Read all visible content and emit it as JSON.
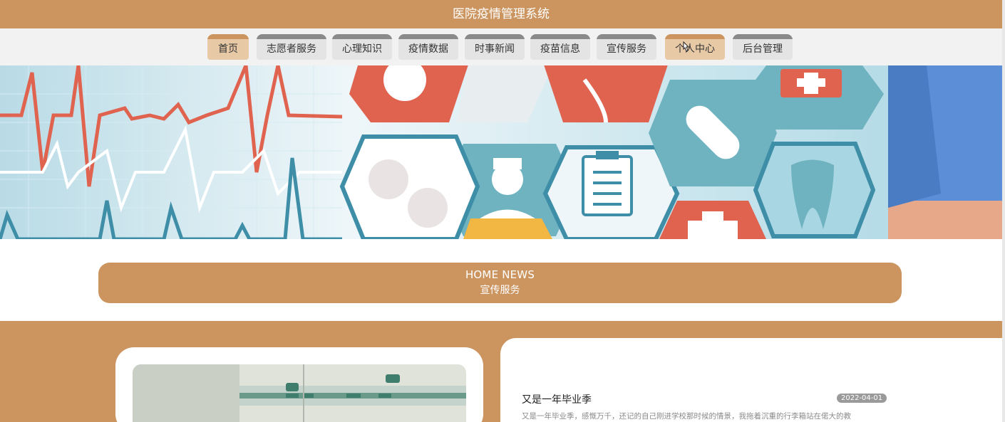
{
  "header": {
    "title": "医院疫情管理系统"
  },
  "nav": {
    "items": [
      {
        "label": "首页",
        "active": true
      },
      {
        "label": "志愿者服务"
      },
      {
        "label": "心理知识"
      },
      {
        "label": "疫情数据"
      },
      {
        "label": "时事新闻"
      },
      {
        "label": "疫苗信息"
      },
      {
        "label": "宣传服务"
      },
      {
        "label": "个人中心",
        "hovered": true
      },
      {
        "label": "后台管理"
      }
    ]
  },
  "banner": {
    "icon": "medical-hexagon-banner-image"
  },
  "section": {
    "title_en": "HOME NEWS",
    "title_zh": "宣传服务"
  },
  "news": {
    "image_icon": "hospital-room-photo",
    "title": "又是一年毕业季",
    "date": "2022-04-01",
    "excerpt": "又是一年毕业季，感慨万千，还记的自己刚进学校那时候的情景，我拖着沉重的行李箱站在偌大的教"
  },
  "colors": {
    "accent": "#cc9560",
    "nav_bg": "#f2f2f2",
    "tab_inactive": "#e4e4e4",
    "tab_active": "#e8c9a6",
    "banner_red": "#e0634f",
    "banner_teal": "#6fb3c0",
    "banner_yellow": "#f2b642"
  }
}
